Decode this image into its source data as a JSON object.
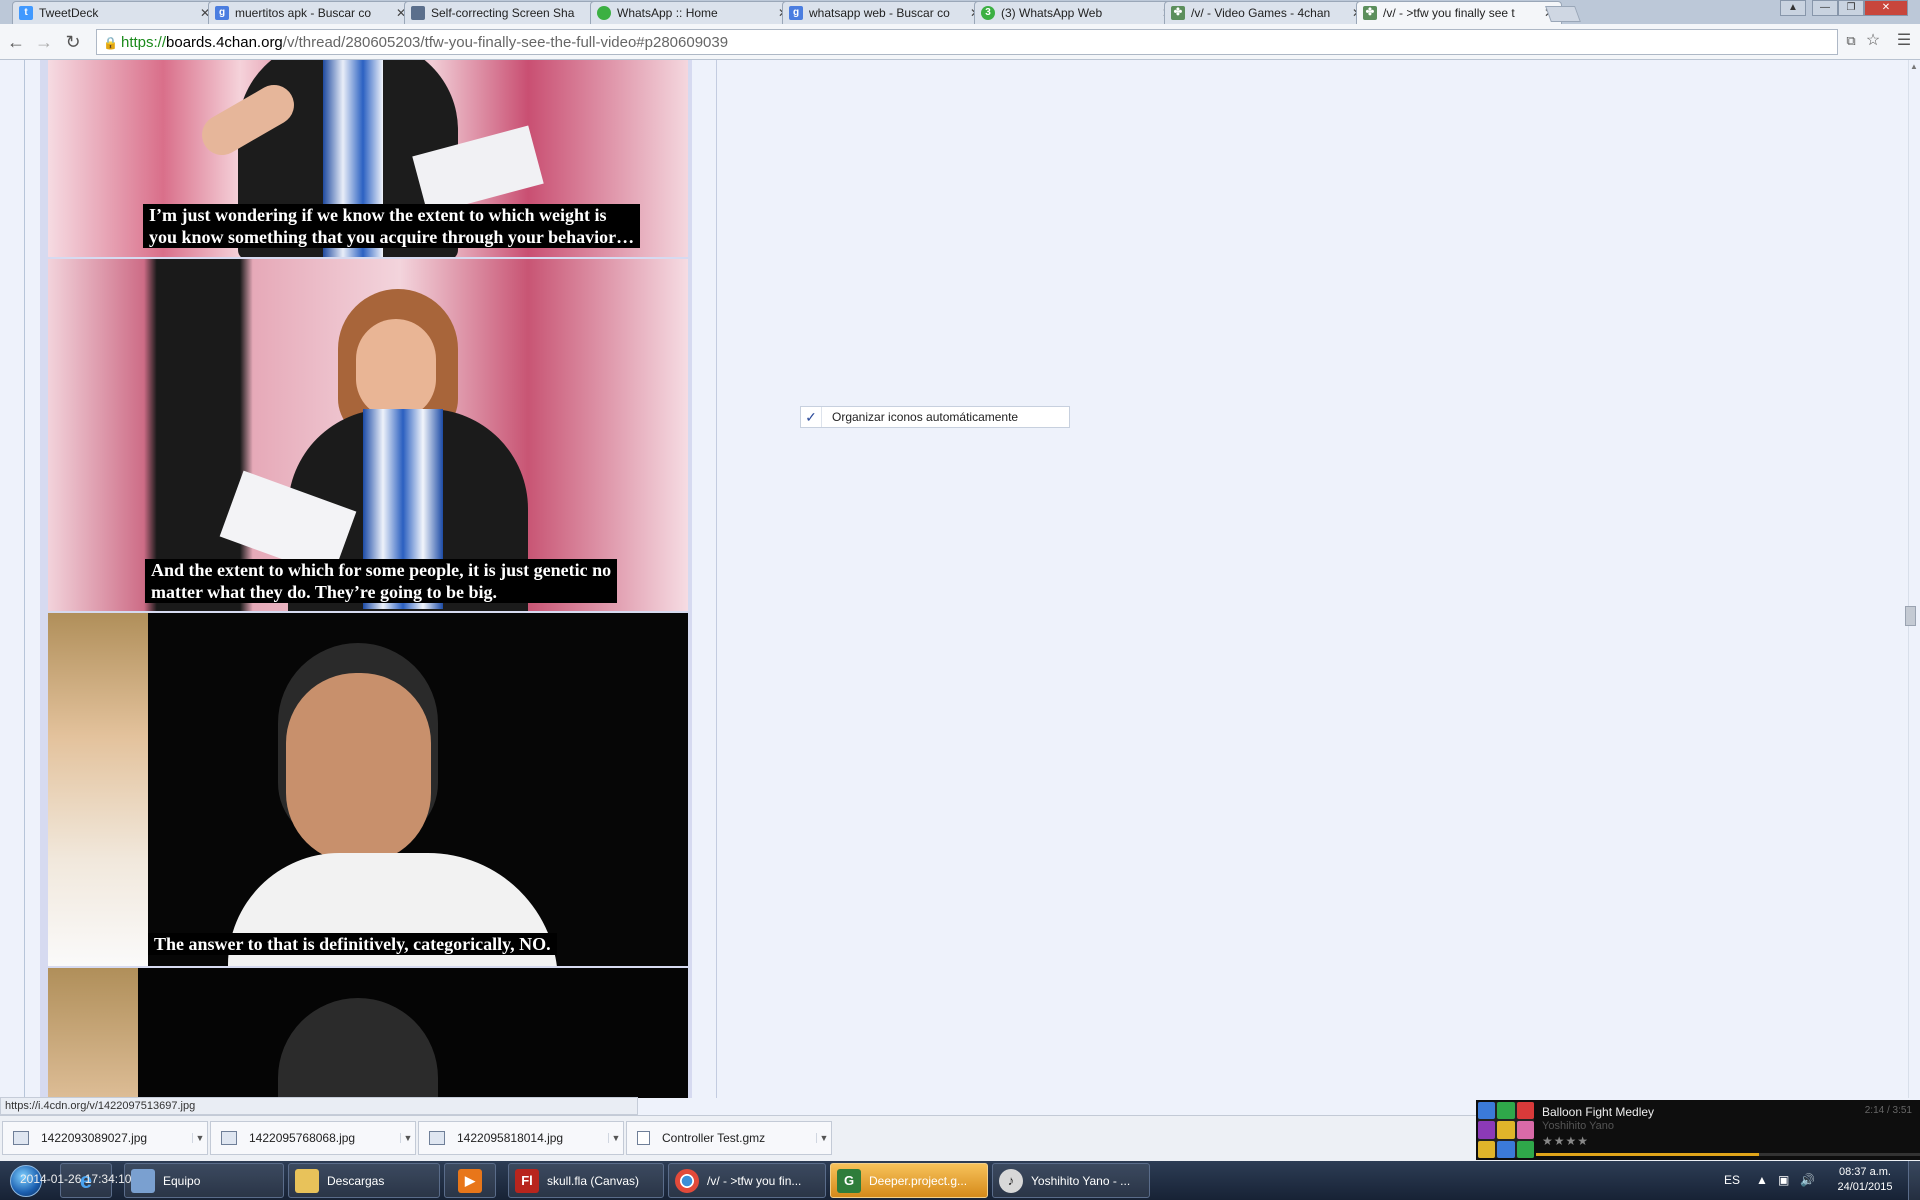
{
  "browser": {
    "tabs": [
      {
        "title": "TweetDeck",
        "icon": "twitter-icon",
        "color": "#4099ff",
        "glyph": "t"
      },
      {
        "title": "muertitos apk - Buscar co",
        "icon": "google-icon",
        "color": "#4a7de0",
        "glyph": "g"
      },
      {
        "title": "Self-correcting Screen Sha",
        "icon": "document-icon",
        "color": "#5b6f8c",
        "glyph": ""
      },
      {
        "title": "WhatsApp :: Home",
        "icon": "whatsapp-icon",
        "color": "#3cb043",
        "glyph": "w"
      },
      {
        "title": "whatsapp web - Buscar co",
        "icon": "google-icon",
        "color": "#4a7de0",
        "glyph": "g"
      },
      {
        "title": "(3) WhatsApp Web",
        "icon": "whatsapp-icon",
        "color": "#3cb043",
        "glyph": "3"
      },
      {
        "title": "/v/ - Video Games - 4chan",
        "icon": "clover-icon",
        "color": "#5c8f5c",
        "glyph": "✤"
      },
      {
        "title": "/v/ - >tfw you finally see t",
        "icon": "clover-icon",
        "color": "#5c8f5c",
        "glyph": "✤"
      }
    ],
    "url_scheme": "https://",
    "url_host": "boards.4chan.org",
    "url_path": "/v/thread/280605203/tfw-you-finally-see-the-full-video#p280609039"
  },
  "captions": {
    "c1_line1": "I’m just wondering if we know the extent to which weight is",
    "c1_line2": "you know something that you acquire through your behavior…",
    "c2_line1": "And the extent to which for some people, it is just genetic no",
    "c2_line2": "matter what they do. They’re going to be big.",
    "c3": "The answer to that is definitively, categorically, NO."
  },
  "context_item": {
    "check": "✓",
    "label": "Organizar iconos automáticamente"
  },
  "status_url": "https://i.4cdn.org/v/1422097513697.jpg",
  "downloads": [
    {
      "name": "1422093089027.jpg",
      "type": "image"
    },
    {
      "name": "1422095768068.jpg",
      "type": "image"
    },
    {
      "name": "1422095818014.jpg",
      "type": "image"
    },
    {
      "name": "Controller Test.gmz",
      "type": "file"
    }
  ],
  "music": {
    "song": "Balloon Fight Medley",
    "artist": "Yoshihito Yano",
    "time": "2:14 / 3:51",
    "stars": "★★★★",
    "progress": 0.58
  },
  "taskbar": {
    "overlay_text": "2014-01-26 17:34:10",
    "items": [
      {
        "label": "Equipo",
        "icon": "computer-icon",
        "color": "#7aa0d0"
      },
      {
        "label": "Descargas",
        "icon": "folder-icon",
        "color": "#e8c25a"
      },
      {
        "label": "",
        "icon": "media-player-icon",
        "color": "#e8761a"
      },
      {
        "label": "skull.fla (Canvas)",
        "icon": "flash-icon",
        "color": "#b8251d"
      },
      {
        "label": "/v/ - >tfw you fin...",
        "icon": "chrome-icon",
        "color": "#3b8fd8"
      },
      {
        "label": "Deeper.project.g...",
        "icon": "gamemaker-icon",
        "color": "#2f7d3b"
      },
      {
        "label": "Yoshihito Yano - ...",
        "icon": "music-player-icon",
        "color": "#d8d8d8"
      }
    ],
    "lang": "ES",
    "time": "08:37 a.m.",
    "date": "24/01/2015"
  }
}
